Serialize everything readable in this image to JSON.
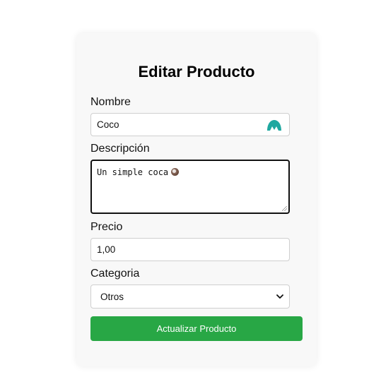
{
  "form": {
    "title": "Editar Producto",
    "name_label": "Nombre",
    "name_value": "Coco",
    "description_label": "Descripción",
    "description_value": "Un simple coca",
    "price_label": "Precio",
    "price_value": "1,00",
    "category_label": "Categoria",
    "category_selected": "Otros",
    "submit_label": "Actualizar Producto"
  },
  "colors": {
    "submit_button": "#28a745",
    "card_background": "#f8f8f8",
    "password_manager_icon": "#1fa8a0"
  },
  "icons": {
    "name_field_icon": "password-manager-icon",
    "description_emoji": "coconut-icon",
    "select_arrow": "chevron-down-icon"
  }
}
